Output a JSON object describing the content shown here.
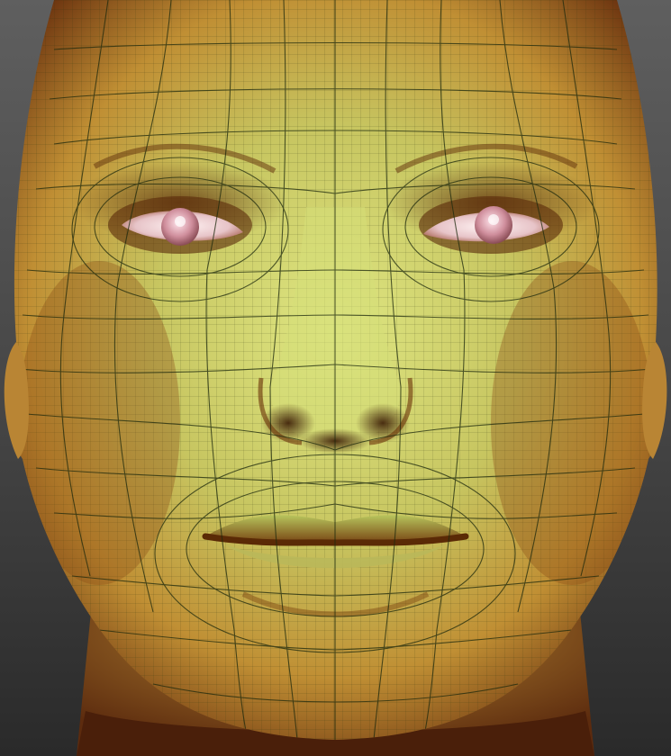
{
  "scene": {
    "subject": "sculpted-head-front-view",
    "colors": {
      "background_top": "#5f5f5f",
      "background_bottom": "#2a2a2a",
      "skin_highlight": "#d8e27a",
      "skin_mid": "#c9a33e",
      "skin_shadow": "#7a3f14",
      "wireframe": "#1e2a0e",
      "eye_sclera": "#f0d8dc",
      "iris": "#c9869a"
    }
  }
}
